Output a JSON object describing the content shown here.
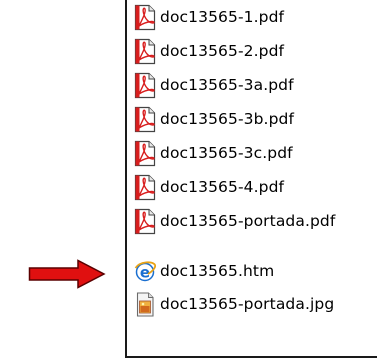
{
  "explorer": {
    "files": [
      {
        "name": "doc13565-1.pdf",
        "icon": "pdf-icon",
        "type": "pdf"
      },
      {
        "name": "doc13565-2.pdf",
        "icon": "pdf-icon",
        "type": "pdf"
      },
      {
        "name": "doc13565-3a.pdf",
        "icon": "pdf-icon",
        "type": "pdf"
      },
      {
        "name": "doc13565-3b.pdf",
        "icon": "pdf-icon",
        "type": "pdf"
      },
      {
        "name": "doc13565-3c.pdf",
        "icon": "pdf-icon",
        "type": "pdf"
      },
      {
        "name": "doc13565-4.pdf",
        "icon": "pdf-icon",
        "type": "pdf"
      },
      {
        "name": "doc13565-portada.pdf",
        "icon": "pdf-icon",
        "type": "pdf"
      },
      {
        "name": "doc13565.htm",
        "icon": "internet-explorer-icon",
        "type": "htm"
      },
      {
        "name": "doc13565-portada.jpg",
        "icon": "image-file-icon",
        "type": "jpg"
      }
    ]
  },
  "annotation": {
    "arrow_icon": "arrow-right-icon",
    "arrow_color": "#e01010",
    "points_to_file": "doc13565.htm"
  },
  "colors": {
    "pdf_red": "#d81e1e",
    "ie_blue": "#1a6fd0",
    "text": "#000000"
  }
}
